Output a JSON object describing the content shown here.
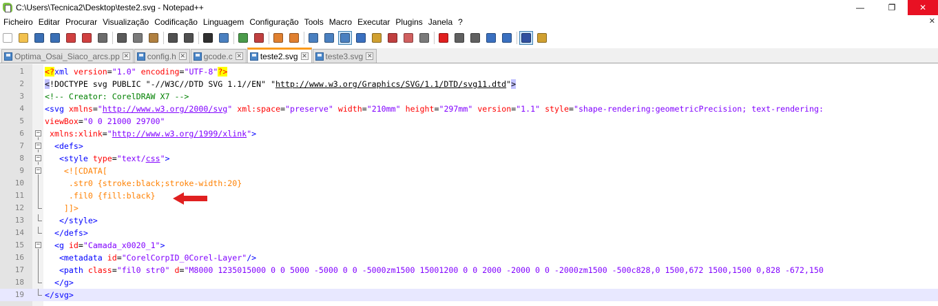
{
  "window": {
    "title": "C:\\Users\\Tecnica2\\Desktop\\teste2.svg - Notepad++",
    "minimize": "—",
    "maximize": "❐",
    "close": "✕"
  },
  "menu": [
    "Ficheiro",
    "Editar",
    "Procurar",
    "Visualização",
    "Codificação",
    "Linguagem",
    "Configuração",
    "Tools",
    "Macro",
    "Executar",
    "Plugins",
    "Janela",
    "?"
  ],
  "menu_close": "✕",
  "toolbar": {
    "icons": [
      {
        "name": "new-file-icon",
        "color": "#ffffff"
      },
      {
        "name": "open-file-icon",
        "color": "#f2c14e"
      },
      {
        "name": "save-icon",
        "color": "#3a6fb5"
      },
      {
        "name": "save-all-icon",
        "color": "#3a6fb5"
      },
      {
        "name": "close-icon",
        "color": "#d04040"
      },
      {
        "name": "close-all-icon",
        "color": "#d04040"
      },
      {
        "name": "print-icon",
        "color": "#6b6b6b"
      },
      {
        "name": "sep"
      },
      {
        "name": "cut-icon",
        "color": "#5a5a5a"
      },
      {
        "name": "copy-icon",
        "color": "#7a7a7a"
      },
      {
        "name": "paste-icon",
        "color": "#b08040"
      },
      {
        "name": "sep"
      },
      {
        "name": "undo-icon",
        "color": "#505050"
      },
      {
        "name": "redo-icon",
        "color": "#505050"
      },
      {
        "name": "sep"
      },
      {
        "name": "find-icon",
        "color": "#303030"
      },
      {
        "name": "replace-icon",
        "color": "#4a80c0"
      },
      {
        "name": "sep"
      },
      {
        "name": "zoom-in-icon",
        "color": "#4a9a4a"
      },
      {
        "name": "zoom-out-icon",
        "color": "#c04040"
      },
      {
        "name": "sep"
      },
      {
        "name": "sync-vertical-icon",
        "color": "#e08030"
      },
      {
        "name": "sync-horizontal-icon",
        "color": "#e08030"
      },
      {
        "name": "sep"
      },
      {
        "name": "word-wrap-icon",
        "color": "#4a80c0"
      },
      {
        "name": "show-all-chars-icon",
        "color": "#4a80c0"
      },
      {
        "name": "indent-guide-icon",
        "color": "#4a80c0",
        "active": true
      },
      {
        "name": "lang-icon",
        "color": "#3a70c0"
      },
      {
        "name": "doc-map-icon",
        "color": "#d0a030"
      },
      {
        "name": "function-list-icon",
        "color": "#c04040"
      },
      {
        "name": "folder-workspace-icon",
        "color": "#d06060"
      },
      {
        "name": "monitor-icon",
        "color": "#7a7a7a"
      },
      {
        "name": "sep"
      },
      {
        "name": "record-macro-icon",
        "color": "#e02020"
      },
      {
        "name": "stop-macro-icon",
        "color": "#606060"
      },
      {
        "name": "play-macro-icon",
        "color": "#606060"
      },
      {
        "name": "run-macro-multiple-icon",
        "color": "#3a70c0"
      },
      {
        "name": "save-macro-icon",
        "color": "#3a70c0"
      },
      {
        "name": "sep"
      },
      {
        "name": "spell-check-icon",
        "color": "#3050a0",
        "active": true
      },
      {
        "name": "spell-options-icon",
        "color": "#d0a030"
      }
    ]
  },
  "tabs": [
    {
      "label": "Optima_Osai_Siaco_arcs.pp",
      "active": false
    },
    {
      "label": "config.h",
      "active": false
    },
    {
      "label": "gcode.c",
      "active": false
    },
    {
      "label": "teste2.svg",
      "active": true
    },
    {
      "label": "teste3.svg",
      "active": false
    }
  ],
  "tab_close": "✕",
  "editor": {
    "current_line": 19,
    "lines": [
      {
        "n": "1",
        "fold": "",
        "seg": [
          [
            "hl",
            "<?"
          ],
          [
            "t",
            "xml "
          ],
          [
            "a",
            "version"
          ],
          [
            "blk",
            "="
          ],
          [
            "v",
            "\"1.0\""
          ],
          [
            "blk",
            " "
          ],
          [
            "a",
            "encoding"
          ],
          [
            "blk",
            "="
          ],
          [
            "v",
            "\"UTF-8\""
          ],
          [
            "hl",
            "?>"
          ]
        ]
      },
      {
        "n": "2",
        "fold": "",
        "seg": [
          [
            "hlb",
            "<"
          ],
          [
            "blk",
            "!DOCTYPE svg PUBLIC \"-//W3C//DTD SVG 1.1//EN\" \""
          ],
          [
            "u",
            "http://www.w3.org/Graphics/SVG/1.1/DTD/svg11.dtd"
          ],
          [
            "blk",
            "\""
          ],
          [
            "hlb",
            ">"
          ]
        ]
      },
      {
        "n": "3",
        "fold": "",
        "seg": [
          [
            "c",
            "<!-- Creator: CorelDRAW X7 -->"
          ]
        ]
      },
      {
        "n": "4",
        "fold": "",
        "seg": [
          [
            "t",
            "<svg "
          ],
          [
            "a",
            "xmlns"
          ],
          [
            "blk",
            "="
          ],
          [
            "v",
            "\""
          ],
          [
            "vu",
            "http://www.w3.org/2000/svg"
          ],
          [
            "v",
            "\""
          ],
          [
            "blk",
            " "
          ],
          [
            "a",
            "xml:space"
          ],
          [
            "blk",
            "="
          ],
          [
            "v",
            "\"preserve\""
          ],
          [
            "blk",
            " "
          ],
          [
            "a",
            "width"
          ],
          [
            "blk",
            "="
          ],
          [
            "v",
            "\"210mm\""
          ],
          [
            "blk",
            " "
          ],
          [
            "a",
            "height"
          ],
          [
            "blk",
            "="
          ],
          [
            "v",
            "\"297mm\""
          ],
          [
            "blk",
            " "
          ],
          [
            "a",
            "version"
          ],
          [
            "blk",
            "="
          ],
          [
            "v",
            "\"1.1\""
          ],
          [
            "blk",
            " "
          ],
          [
            "a",
            "style"
          ],
          [
            "blk",
            "="
          ],
          [
            "v",
            "\"shape-rendering:geometricPrecision; text-rendering:"
          ]
        ]
      },
      {
        "n": "5",
        "fold": "",
        "seg": [
          [
            "a",
            "viewBox"
          ],
          [
            "blk",
            "="
          ],
          [
            "v",
            "\"0 0 21000 29700\""
          ]
        ]
      },
      {
        "n": "6",
        "fold": "open",
        "seg": [
          [
            "blk",
            " "
          ],
          [
            "a",
            "xmlns:xlink"
          ],
          [
            "blk",
            "="
          ],
          [
            "v",
            "\""
          ],
          [
            "vu",
            "http://www.w3.org/1999/xlink"
          ],
          [
            "v",
            "\""
          ],
          [
            "t",
            ">"
          ]
        ]
      },
      {
        "n": "7",
        "fold": "open",
        "seg": [
          [
            "t",
            "  <defs>"
          ]
        ]
      },
      {
        "n": "8",
        "fold": "open",
        "seg": [
          [
            "t",
            "   <style "
          ],
          [
            "a",
            "type"
          ],
          [
            "blk",
            "="
          ],
          [
            "v",
            "\"text/"
          ],
          [
            "vu",
            "css"
          ],
          [
            "v",
            "\""
          ],
          [
            "t",
            ">"
          ]
        ]
      },
      {
        "n": "9",
        "fold": "open",
        "seg": [
          [
            "cd",
            "    <![CDATA["
          ]
        ]
      },
      {
        "n": "10",
        "fold": "mid",
        "seg": [
          [
            "cd",
            "     .str0 {stroke:black;stroke-width:20}"
          ]
        ]
      },
      {
        "n": "11",
        "fold": "mid",
        "seg": [
          [
            "cd",
            "     .fil0 {fill:black}"
          ]
        ]
      },
      {
        "n": "12",
        "fold": "end",
        "seg": [
          [
            "cd",
            "    ]]>"
          ]
        ]
      },
      {
        "n": "13",
        "fold": "end",
        "seg": [
          [
            "t",
            "   </style>"
          ]
        ]
      },
      {
        "n": "14",
        "fold": "end",
        "seg": [
          [
            "t",
            "  </defs>"
          ]
        ]
      },
      {
        "n": "15",
        "fold": "open",
        "seg": [
          [
            "t",
            "  <g "
          ],
          [
            "a",
            "id"
          ],
          [
            "blk",
            "="
          ],
          [
            "v",
            "\"Camada_x0020_1\""
          ],
          [
            "t",
            ">"
          ]
        ]
      },
      {
        "n": "16",
        "fold": "mid",
        "seg": [
          [
            "t",
            "   <metadata "
          ],
          [
            "a",
            "id"
          ],
          [
            "blk",
            "="
          ],
          [
            "v",
            "\"CorelCorpID_0Corel-Layer\""
          ],
          [
            "t",
            "/>"
          ]
        ]
      },
      {
        "n": "17",
        "fold": "mid",
        "seg": [
          [
            "t",
            "   <path "
          ],
          [
            "a",
            "class"
          ],
          [
            "blk",
            "="
          ],
          [
            "v",
            "\"fil0 str0\""
          ],
          [
            "blk",
            " "
          ],
          [
            "a",
            "d"
          ],
          [
            "blk",
            "="
          ],
          [
            "v",
            "\"M8000 1235015000 0 0 5000 -5000 0 0 -5000zm1500 15001200 0 0 2000 -2000 0 0 -2000zm1500 -500c828,0 1500,672 1500,1500 0,828 -672,150"
          ]
        ]
      },
      {
        "n": "18",
        "fold": "end",
        "seg": [
          [
            "t",
            "  </g>"
          ]
        ]
      },
      {
        "n": "19",
        "fold": "end",
        "seg": [
          [
            "t",
            "</svg>"
          ]
        ]
      }
    ]
  },
  "colors": {
    "tag": "#0000ff",
    "attribute": "#ff0000",
    "value": "#8000ff",
    "comment": "#008000",
    "cdata": "#ff8000",
    "arrow": "#e02020",
    "active_tab_top": "#fa9a1c"
  }
}
